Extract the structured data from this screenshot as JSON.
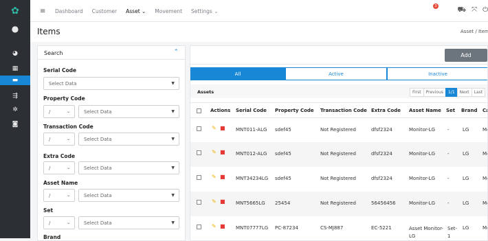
{
  "nav": {
    "items": [
      {
        "label": "Dashboard",
        "active": false
      },
      {
        "label": "Customer",
        "active": false
      },
      {
        "label": "Asset ⌄",
        "active": true
      },
      {
        "label": "Movement",
        "active": false
      },
      {
        "label": "Settings ⌄",
        "active": false
      }
    ],
    "notif_count": "3"
  },
  "page": {
    "title": "Items",
    "breadcrumb": "Asset / Item"
  },
  "search": {
    "header": "Search",
    "serial_label": "Serial Code",
    "serial_placeholder": "Select Data",
    "property_label": "Property Code",
    "transaction_label": "Transaction Code",
    "extra_label": "Extra Code",
    "asset_name_label": "Asset Name",
    "set_label": "Set",
    "brand_label": "Brand",
    "op": "/",
    "select_placeholder": "Select Data"
  },
  "toolbar": {
    "add_label": "Add"
  },
  "tabs": [
    "All",
    "Active",
    "Inactive"
  ],
  "table": {
    "caption": "Assets",
    "pager": [
      "First",
      "Previous",
      "1/1",
      "Next",
      "Last"
    ],
    "columns": [
      "Actions",
      "Serial Code",
      "Property Code",
      "Transaction Code",
      "Extra Code",
      "Asset Name",
      "Set",
      "Brand",
      "Ca"
    ],
    "rows": [
      [
        "MNT011-ALG",
        "sdef45",
        "Not Registered",
        "dfsf2324",
        "Monitor-LG",
        "-",
        "LG",
        "Mo"
      ],
      [
        "MNT012-ALG",
        "sdef45",
        "Not Registered",
        "dfsf2324",
        "Monitor-LG",
        "-",
        "LG",
        "Mo"
      ],
      [
        "MNT34234LG",
        "sdef45",
        "Not Registered",
        "dfsf2324",
        "Monitor-LG",
        "-",
        "LG",
        "Mo"
      ],
      [
        "MNT5665LG",
        "25454",
        "Not Registered",
        "56456456",
        "Monitor-LG",
        "-",
        "LG",
        "Mo"
      ],
      [
        "MNT07777LG",
        "PC-87234",
        "CS-MJ887",
        "EC-5221",
        "Asset Monitor-\nLG",
        "Set-\n1",
        "LG",
        "Mo"
      ]
    ]
  },
  "colors": {
    "accent": "#1787d6",
    "rail": "#2c3035",
    "add_button": "#6c757d"
  }
}
